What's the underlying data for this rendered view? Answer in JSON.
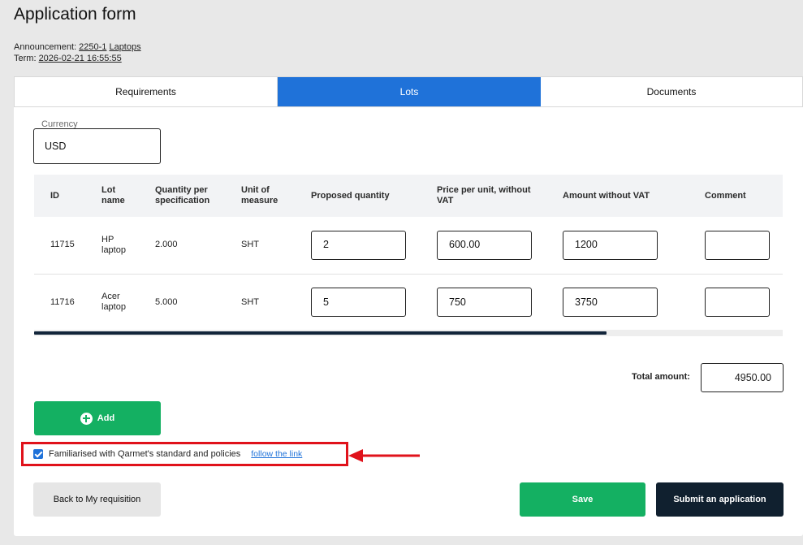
{
  "page": {
    "title": "Application form",
    "announcement_label": "Announcement:",
    "announcement_id": "2250-1",
    "announcement_name": "Laptops",
    "term_label": "Term:",
    "term_value": "2026-02-21 16:55:55"
  },
  "tabs": [
    {
      "label": "Requirements",
      "active": false
    },
    {
      "label": "Lots",
      "active": true
    },
    {
      "label": "Documents",
      "active": false
    }
  ],
  "currency": {
    "label": "Currency",
    "value": "USD"
  },
  "table": {
    "headers": [
      "ID",
      "Lot name",
      "Quantity per specification",
      "Unit of measure",
      "Proposed quantity",
      "Price per unit, without VAT",
      "Amount without VAT",
      "Comment"
    ],
    "rows": [
      {
        "id": "11715",
        "lot_name": "HP laptop",
        "qty_spec": "2.000",
        "unit": "SHT",
        "proposed_qty": "2",
        "price": "600.00",
        "amount": "1200",
        "comment": ""
      },
      {
        "id": "11716",
        "lot_name": "Acer laptop",
        "qty_spec": "5.000",
        "unit": "SHT",
        "proposed_qty": "5",
        "price": "750",
        "amount": "3750",
        "comment": ""
      }
    ]
  },
  "total": {
    "label": "Total amount:",
    "value": "4950.00"
  },
  "buttons": {
    "add": "Add",
    "back": "Back to My requisition",
    "save": "Save",
    "submit": "Submit an application"
  },
  "consent": {
    "checked": true,
    "text": "Familiarised with Qarmet's standard and policies",
    "link": "follow the link"
  },
  "colors": {
    "accent_blue": "#1f72d9",
    "green": "#14b062",
    "dark_navy": "#10202f",
    "highlight_red": "#e0121b"
  },
  "icons": [
    "plus-circle-icon",
    "checkbox-checked-icon",
    "annotation-arrow-icon"
  ]
}
